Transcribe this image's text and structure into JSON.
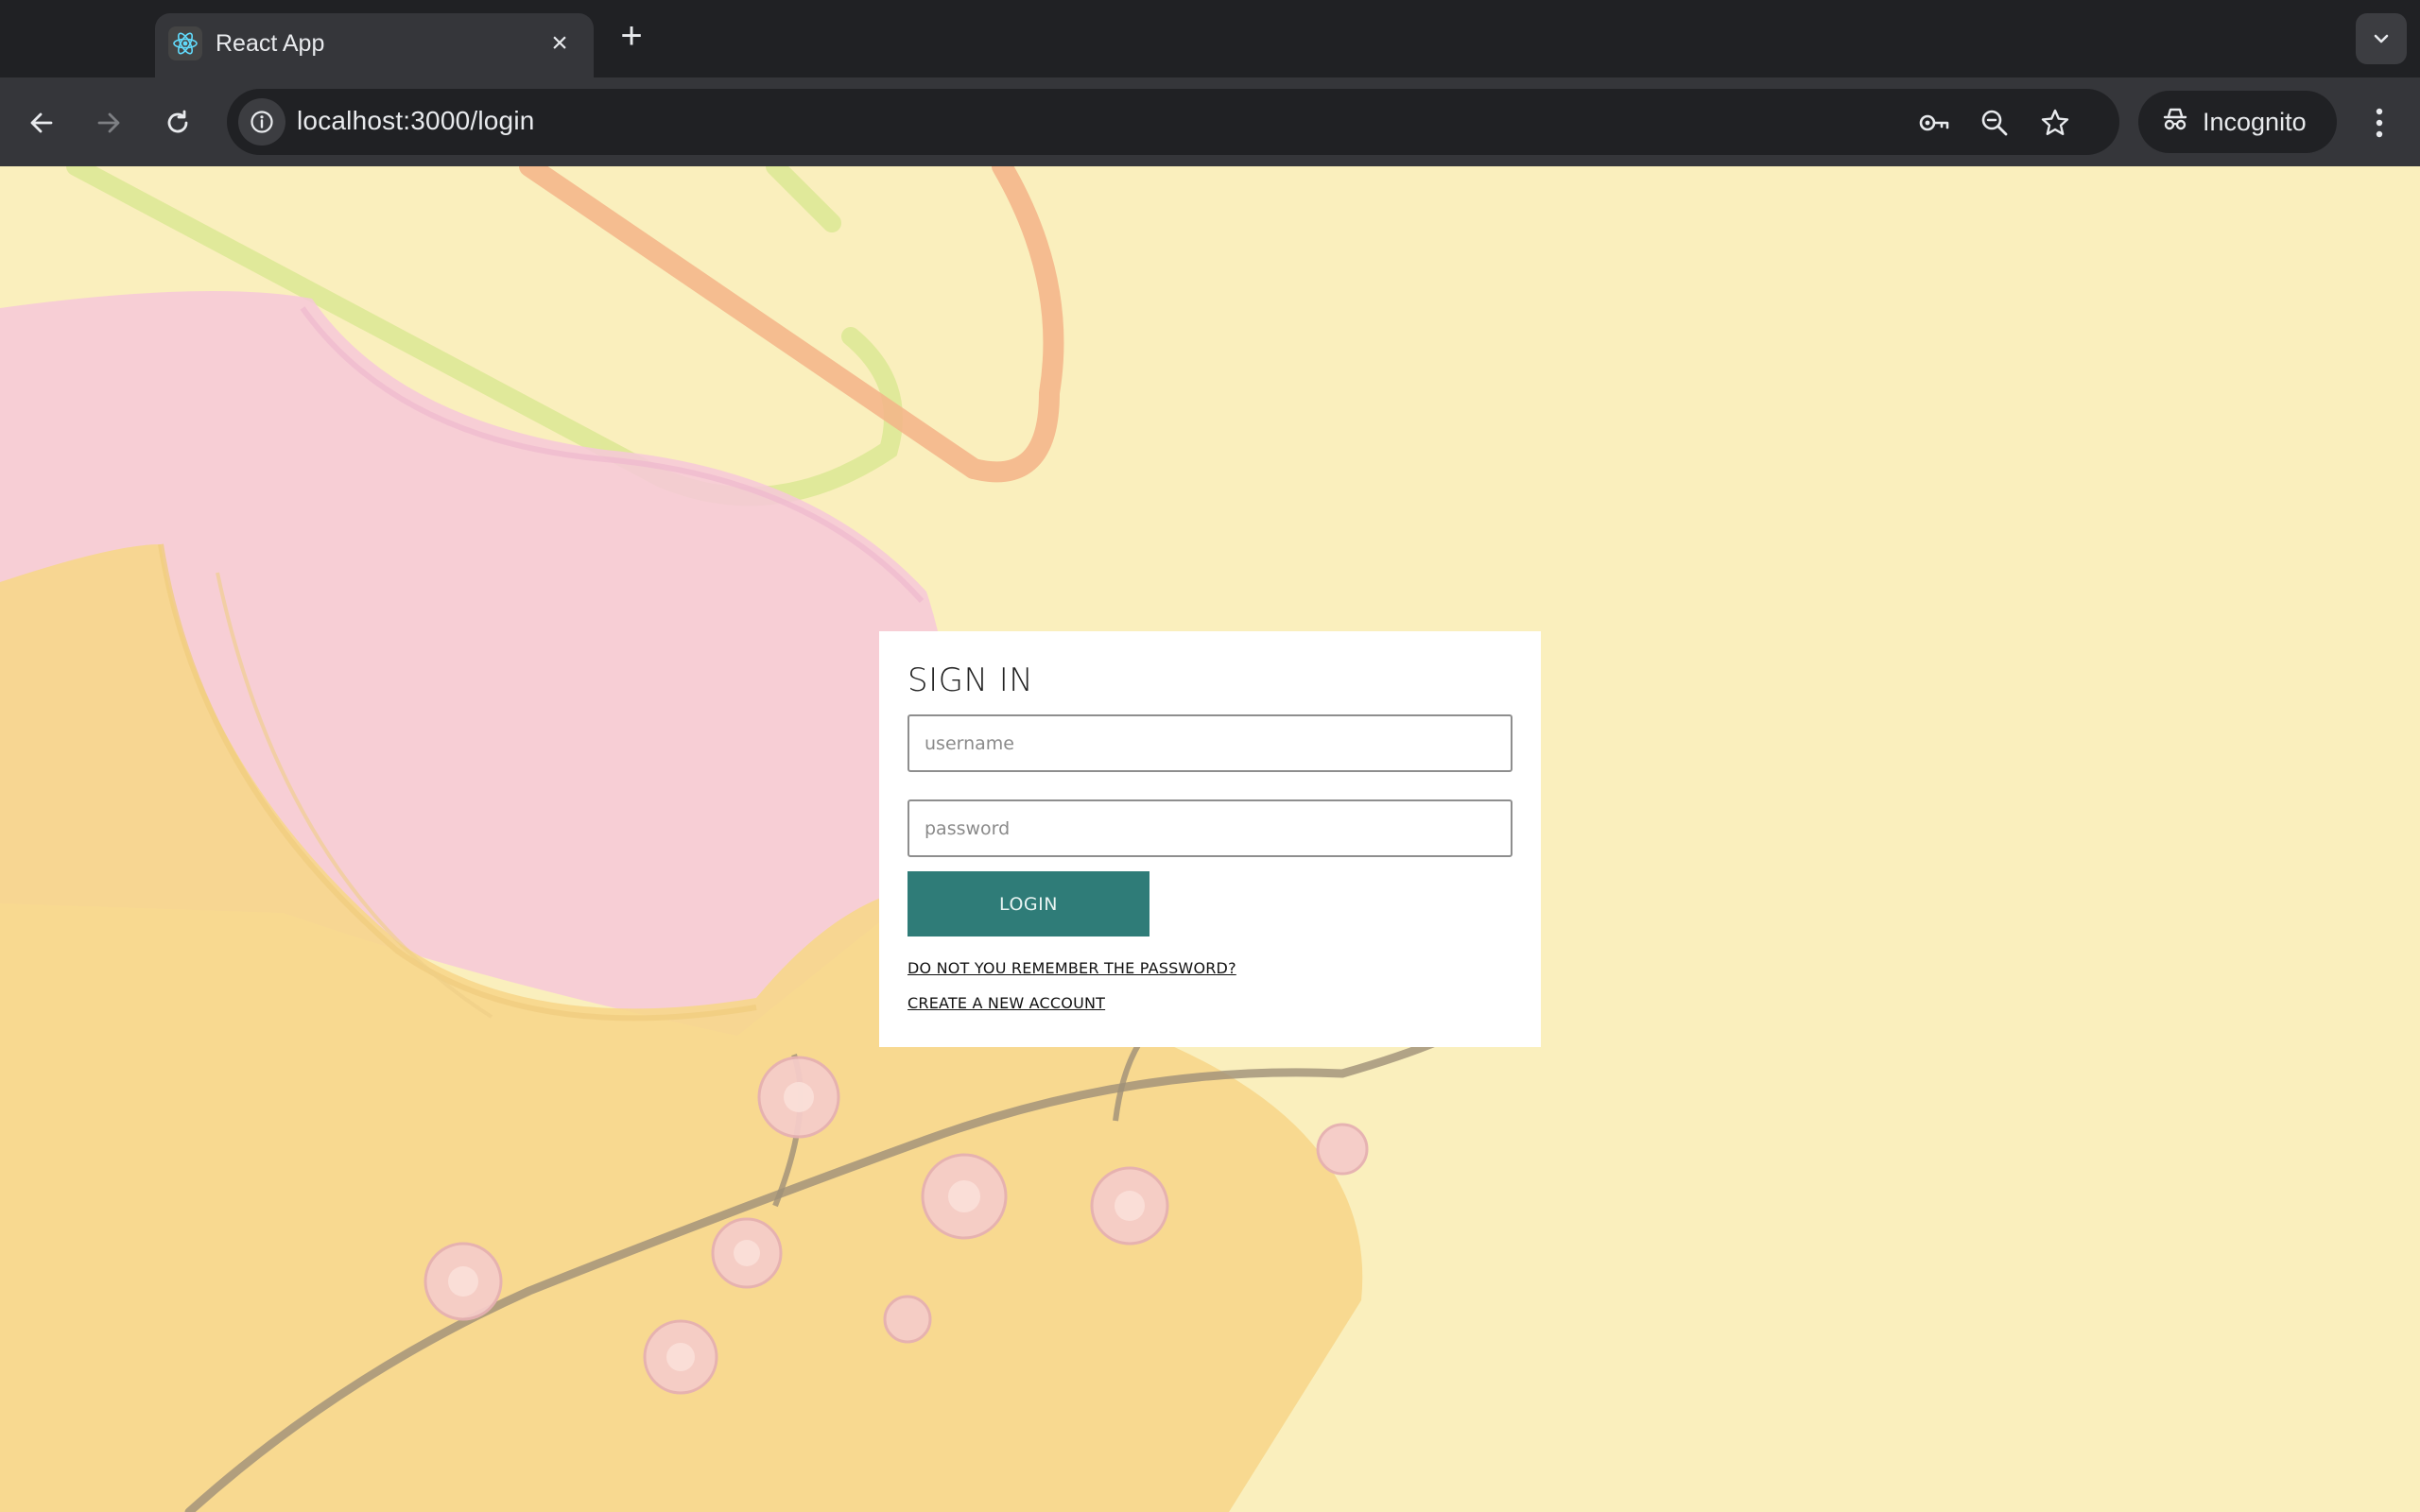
{
  "browser": {
    "tab_title": "React App",
    "url": "localhost:3000/login",
    "incognito_label": "Incognito",
    "icons": {
      "favicon": "react-logo-icon",
      "close": "close-icon",
      "new_tab": "plus-icon",
      "tab_search": "chevron-down-icon",
      "back": "arrow-left-icon",
      "forward": "arrow-right-icon",
      "reload": "reload-icon",
      "site_info": "info-icon",
      "passwords": "key-icon",
      "zoom": "zoom-out-icon",
      "bookmark": "star-icon",
      "incognito": "incognito-icon",
      "menu": "kebab-menu-icon"
    }
  },
  "login": {
    "title": "SIGN IN",
    "username_placeholder": "username",
    "password_placeholder": "password",
    "login_button": "LOGIN",
    "forgot_password_link": "DO NOT YOU REMEMBER THE PASSWORD?",
    "create_account_link": "CREATE A NEW ACCOUNT",
    "button_color": "#2f7c78"
  }
}
